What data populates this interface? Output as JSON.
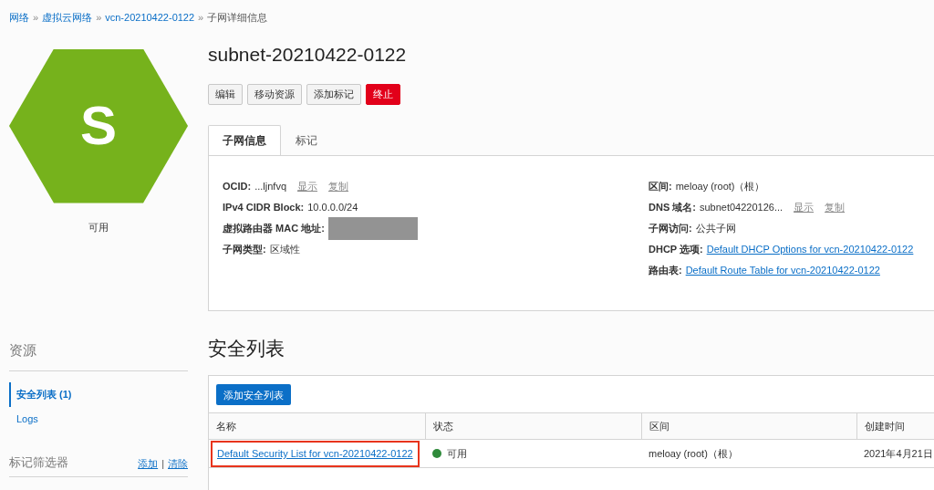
{
  "breadcrumb": [
    {
      "label": "网络",
      "link": true,
      "separator": "»"
    },
    {
      "label": "虚拟云网络",
      "link": true,
      "separator": "»"
    },
    {
      "label": "vcn-20210422-0122",
      "link": true,
      "separator": "»"
    },
    {
      "label": "子网详细信息",
      "link": false
    }
  ],
  "resource": {
    "letter": "S",
    "status": "可用"
  },
  "title": "subnet-20210422-0122",
  "actions": [
    {
      "label": "编辑",
      "kind": "default"
    },
    {
      "label": "移动资源",
      "kind": "default"
    },
    {
      "label": "添加标记",
      "kind": "default"
    },
    {
      "label": "终止",
      "kind": "danger"
    }
  ],
  "tabs": [
    {
      "label": "子网信息",
      "selected": true
    },
    {
      "label": "标记",
      "selected": false
    }
  ],
  "info_left": [
    {
      "label": "OCID:",
      "value": "...ljnfvq",
      "links": [
        "显示",
        "复制"
      ]
    },
    {
      "label": "IPv4 CIDR Block:",
      "value": "10.0.0.0/24"
    },
    {
      "label": "虚拟路由器 MAC 地址:",
      "redacted": true
    },
    {
      "label": "子网类型:",
      "value": "区域性"
    }
  ],
  "info_right": [
    {
      "label": "区间:",
      "value": "meloay (root)（根）"
    },
    {
      "label": "DNS 域名:",
      "value": "subnet04220126...",
      "links": [
        "显示",
        "复制"
      ]
    },
    {
      "label": "子网访问:",
      "value": "公共子网"
    },
    {
      "label": "DHCP 选项:",
      "link_value": "Default DHCP Options for vcn-20210422-0122"
    },
    {
      "label": "路由表:",
      "link_value": "Default Route Table for vcn-20210422-0122"
    }
  ],
  "sidebar": {
    "heading": "资源",
    "items": [
      {
        "label": "安全列表 (1)",
        "selected": true
      },
      {
        "label": "Logs",
        "selected": false
      }
    ],
    "filter": {
      "heading": "标记筛选器",
      "links": [
        "添加",
        "清除"
      ],
      "divider": "|"
    }
  },
  "security_lists": {
    "heading": "安全列表",
    "add_button": "添加安全列表",
    "columns": [
      "名称",
      "状态",
      "区间",
      "创建时间"
    ],
    "rows": [
      {
        "name": "Default Security List for vcn-20210422-0122",
        "highlighted": true,
        "status": "可用",
        "color": "#2f8a3b",
        "compartment": "meloay (root)（根）",
        "created": "2021年4月21日"
      }
    ]
  }
}
